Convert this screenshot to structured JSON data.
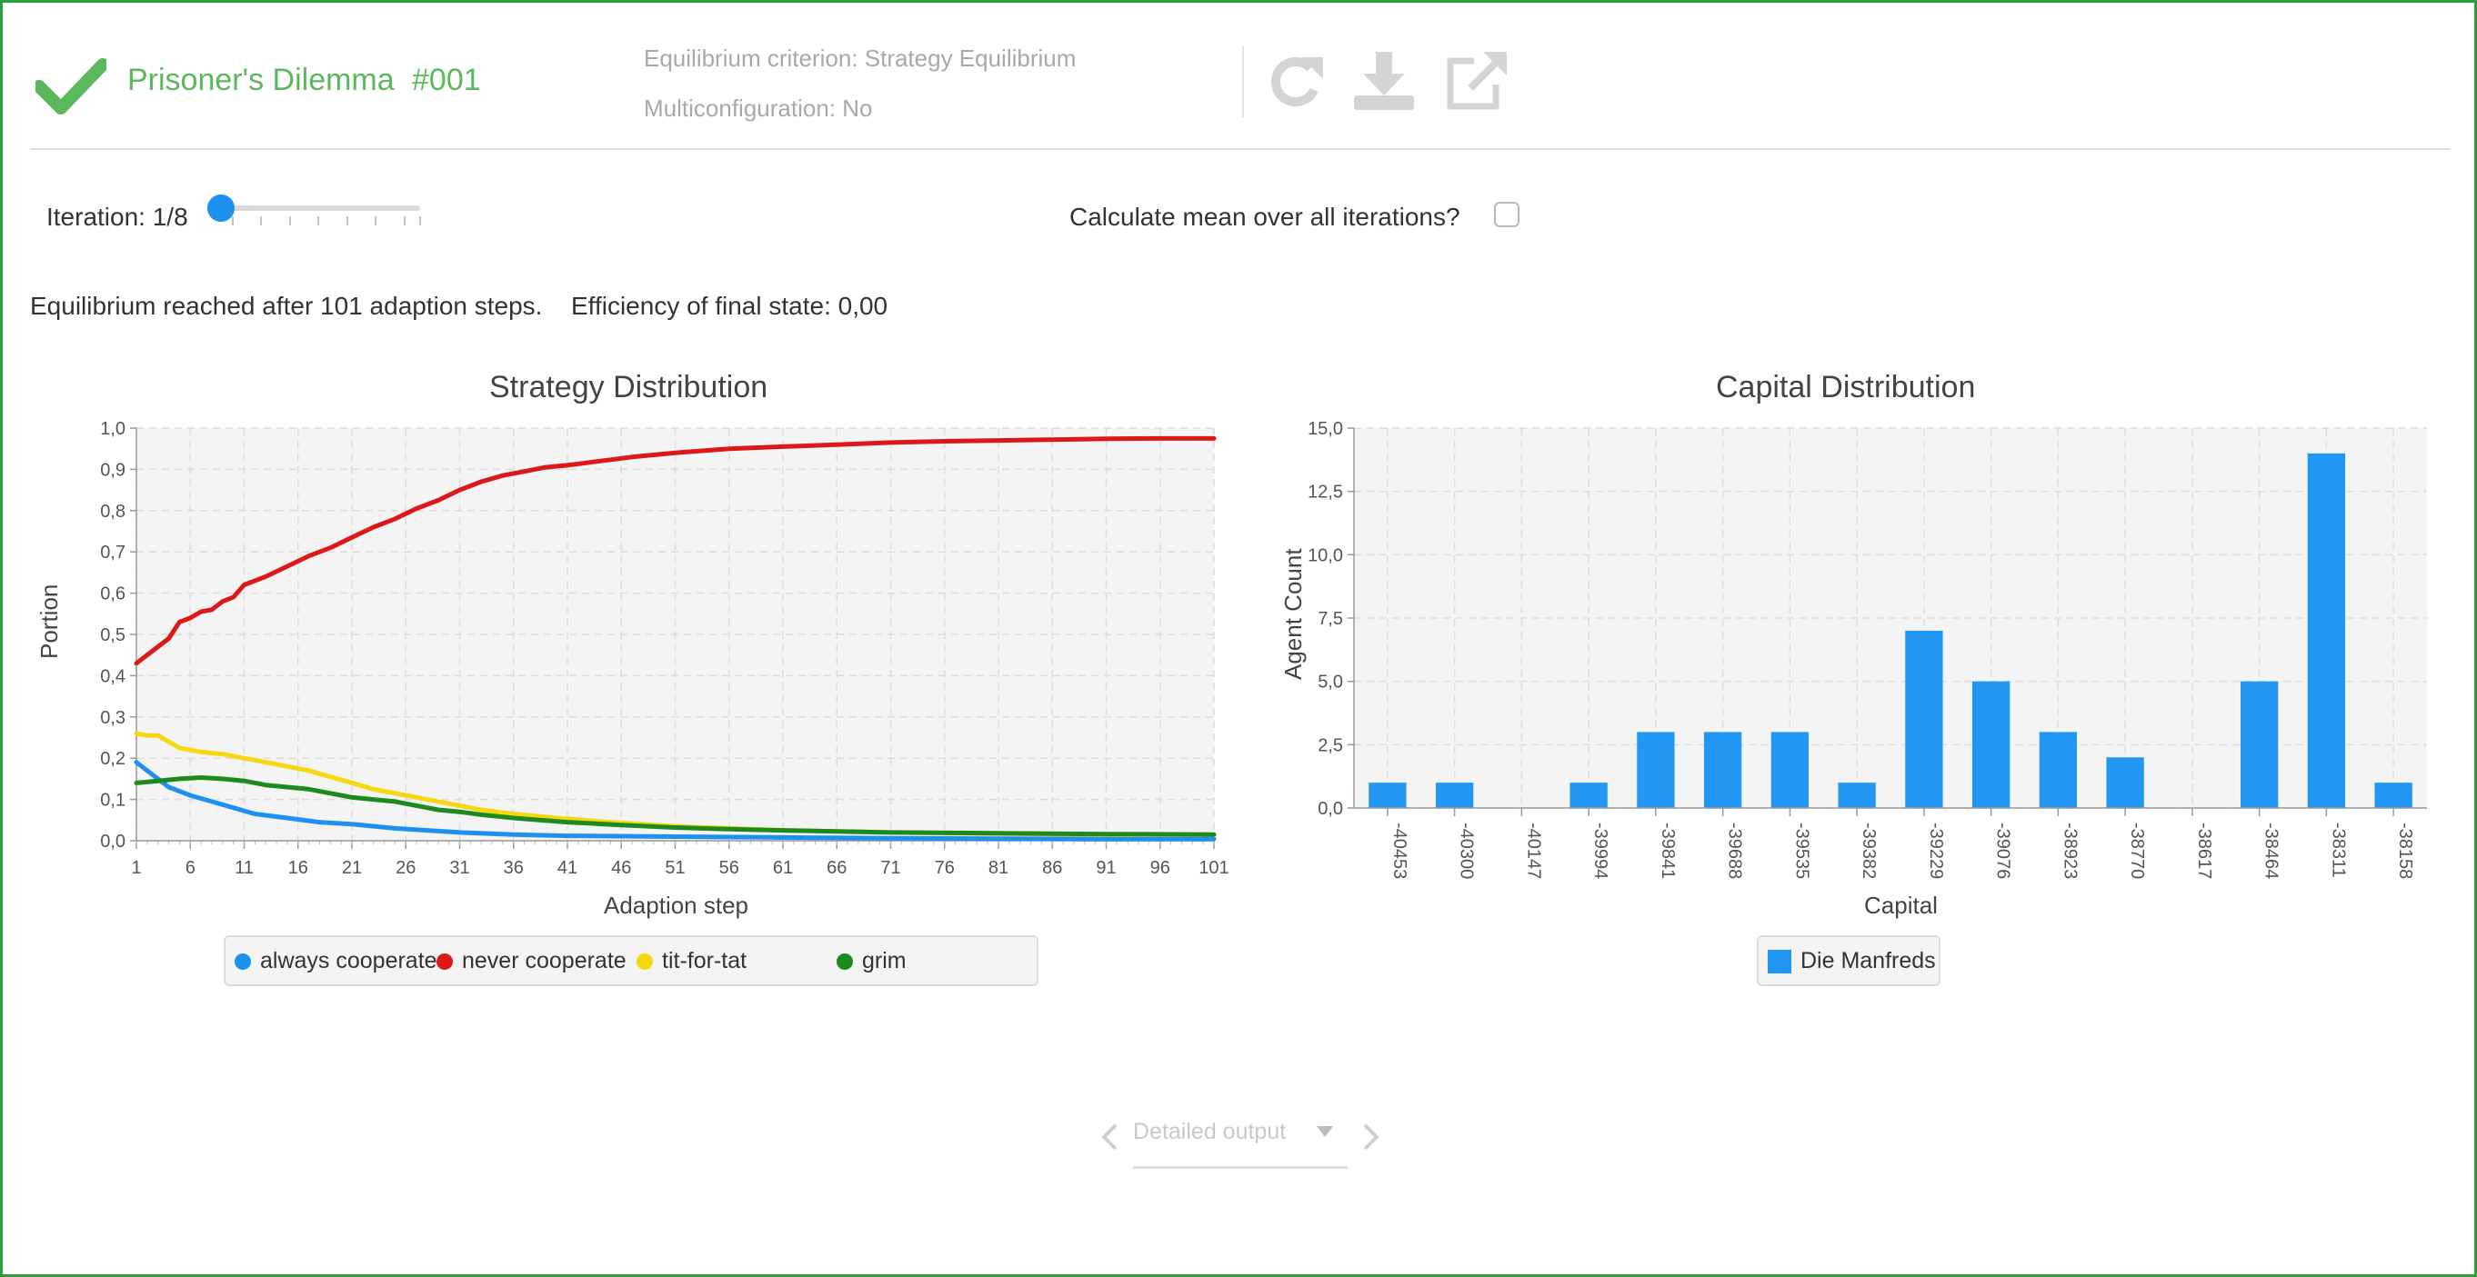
{
  "header": {
    "title": "Prisoner's Dilemma",
    "number": "#001",
    "criterion": "Equilibrium criterion: Strategy Equilibrium",
    "multiconfig": "Multiconfiguration: No",
    "check_icon": "check-icon",
    "refresh_icon": "refresh-icon",
    "download_icon": "download-icon",
    "export_icon": "external-link-icon",
    "accent_color": "#5cb85c"
  },
  "controls": {
    "iteration_label": "Iteration: 1/8",
    "iteration_value": 1,
    "iteration_max": 8,
    "mean_label": "Calculate mean over all iterations?",
    "mean_checked": false
  },
  "status": {
    "equilibrium": "Equilibrium reached after 101 adaption steps.",
    "efficiency": "Efficiency of final state: 0,00"
  },
  "charts": {
    "strategy_title": "Strategy Distribution",
    "capital_title": "Capital Distribution"
  },
  "chart_data": [
    {
      "type": "line",
      "title": "Strategy Distribution",
      "xlabel": "Adaption step",
      "ylabel": "Portion",
      "xlim": [
        1,
        101
      ],
      "ylim": [
        0.0,
        1.0
      ],
      "x_ticks": [
        "1",
        "6",
        "11",
        "16",
        "21",
        "26",
        "31",
        "36",
        "41",
        "46",
        "51",
        "56",
        "61",
        "66",
        "71",
        "76",
        "81",
        "86",
        "91",
        "96",
        "101"
      ],
      "y_ticks": [
        "0,0",
        "0,1",
        "0,2",
        "0,3",
        "0,4",
        "0,5",
        "0,6",
        "0,7",
        "0,8",
        "0,9",
        "1,0"
      ],
      "grid": true,
      "legend": "bottom",
      "series": [
        {
          "name": "always cooperate",
          "color": "#1e90f0",
          "points": [
            [
              1,
              0.19
            ],
            [
              2,
              0.17
            ],
            [
              3,
              0.15
            ],
            [
              4,
              0.13
            ],
            [
              6,
              0.11
            ],
            [
              8,
              0.095
            ],
            [
              10,
              0.08
            ],
            [
              12,
              0.065
            ],
            [
              15,
              0.055
            ],
            [
              18,
              0.045
            ],
            [
              21,
              0.04
            ],
            [
              25,
              0.03
            ],
            [
              28,
              0.025
            ],
            [
              31,
              0.02
            ],
            [
              36,
              0.015
            ],
            [
              41,
              0.012
            ],
            [
              51,
              0.01
            ],
            [
              61,
              0.008
            ],
            [
              71,
              0.006
            ],
            [
              81,
              0.005
            ],
            [
              91,
              0.004
            ],
            [
              101,
              0.004
            ]
          ]
        },
        {
          "name": "never cooperate",
          "color": "#dd1818",
          "points": [
            [
              1,
              0.43
            ],
            [
              2,
              0.45
            ],
            [
              3,
              0.47
            ],
            [
              4,
              0.49
            ],
            [
              5,
              0.53
            ],
            [
              6,
              0.54
            ],
            [
              7,
              0.555
            ],
            [
              8,
              0.56
            ],
            [
              9,
              0.58
            ],
            [
              10,
              0.59
            ],
            [
              11,
              0.62
            ],
            [
              13,
              0.64
            ],
            [
              15,
              0.665
            ],
            [
              17,
              0.69
            ],
            [
              19,
              0.71
            ],
            [
              21,
              0.735
            ],
            [
              23,
              0.76
            ],
            [
              25,
              0.78
            ],
            [
              27,
              0.805
            ],
            [
              29,
              0.825
            ],
            [
              31,
              0.85
            ],
            [
              33,
              0.87
            ],
            [
              35,
              0.885
            ],
            [
              37,
              0.895
            ],
            [
              39,
              0.905
            ],
            [
              41,
              0.91
            ],
            [
              44,
              0.92
            ],
            [
              47,
              0.93
            ],
            [
              51,
              0.94
            ],
            [
              56,
              0.95
            ],
            [
              61,
              0.955
            ],
            [
              66,
              0.96
            ],
            [
              71,
              0.965
            ],
            [
              76,
              0.968
            ],
            [
              81,
              0.97
            ],
            [
              86,
              0.972
            ],
            [
              91,
              0.974
            ],
            [
              96,
              0.975
            ],
            [
              101,
              0.975
            ]
          ]
        },
        {
          "name": "tit-for-tat",
          "color": "#f5d80f",
          "points": [
            [
              1,
              0.26
            ],
            [
              2,
              0.255
            ],
            [
              3,
              0.255
            ],
            [
              4,
              0.24
            ],
            [
              5,
              0.225
            ],
            [
              7,
              0.215
            ],
            [
              9,
              0.21
            ],
            [
              11,
              0.2
            ],
            [
              13,
              0.19
            ],
            [
              15,
              0.18
            ],
            [
              17,
              0.17
            ],
            [
              19,
              0.155
            ],
            [
              21,
              0.14
            ],
            [
              23,
              0.125
            ],
            [
              25,
              0.115
            ],
            [
              27,
              0.105
            ],
            [
              29,
              0.095
            ],
            [
              31,
              0.085
            ],
            [
              33,
              0.075
            ],
            [
              36,
              0.065
            ],
            [
              40,
              0.055
            ],
            [
              45,
              0.045
            ],
            [
              51,
              0.035
            ],
            [
              56,
              0.03
            ],
            [
              61,
              0.025
            ],
            [
              71,
              0.02
            ],
            [
              81,
              0.017
            ],
            [
              91,
              0.015
            ],
            [
              101,
              0.015
            ]
          ]
        },
        {
          "name": "grim",
          "color": "#1e8a1e",
          "points": [
            [
              1,
              0.14
            ],
            [
              3,
              0.145
            ],
            [
              5,
              0.15
            ],
            [
              7,
              0.153
            ],
            [
              9,
              0.15
            ],
            [
              11,
              0.145
            ],
            [
              13,
              0.135
            ],
            [
              15,
              0.13
            ],
            [
              17,
              0.125
            ],
            [
              19,
              0.115
            ],
            [
              21,
              0.105
            ],
            [
              23,
              0.1
            ],
            [
              25,
              0.095
            ],
            [
              27,
              0.085
            ],
            [
              29,
              0.075
            ],
            [
              31,
              0.07
            ],
            [
              33,
              0.063
            ],
            [
              36,
              0.055
            ],
            [
              41,
              0.045
            ],
            [
              46,
              0.038
            ],
            [
              51,
              0.032
            ],
            [
              56,
              0.028
            ],
            [
              61,
              0.025
            ],
            [
              71,
              0.02
            ],
            [
              81,
              0.018
            ],
            [
              91,
              0.016
            ],
            [
              101,
              0.015
            ]
          ]
        }
      ]
    },
    {
      "type": "bar",
      "title": "Capital Distribution",
      "xlabel": "Capital",
      "ylabel": "Agent Count",
      "ylim": [
        0.0,
        15.0
      ],
      "y_ticks": [
        "0,0",
        "2,5",
        "5,0",
        "7,5",
        "10,0",
        "12,5",
        "15,0"
      ],
      "grid": true,
      "legend": "bottom",
      "categories": [
        "-40453",
        "-40300",
        "-40147",
        "-39994",
        "-39841",
        "-39688",
        "-39535",
        "-39382",
        "-39229",
        "-39076",
        "-38923",
        "-38770",
        "-38617",
        "-38464",
        "-38311",
        "-38158"
      ],
      "series": [
        {
          "name": "Die Manfreds",
          "color": "#2196f3",
          "values": [
            1,
            1,
            0,
            1,
            3,
            3,
            3,
            1,
            7,
            5,
            3,
            2,
            0,
            5,
            14,
            1
          ]
        }
      ]
    }
  ],
  "footer": {
    "dropdown_label": "Detailed output",
    "prev_icon": "chevron-left-icon",
    "next_icon": "chevron-right-icon",
    "dropdown_icon": "caret-down-icon"
  }
}
